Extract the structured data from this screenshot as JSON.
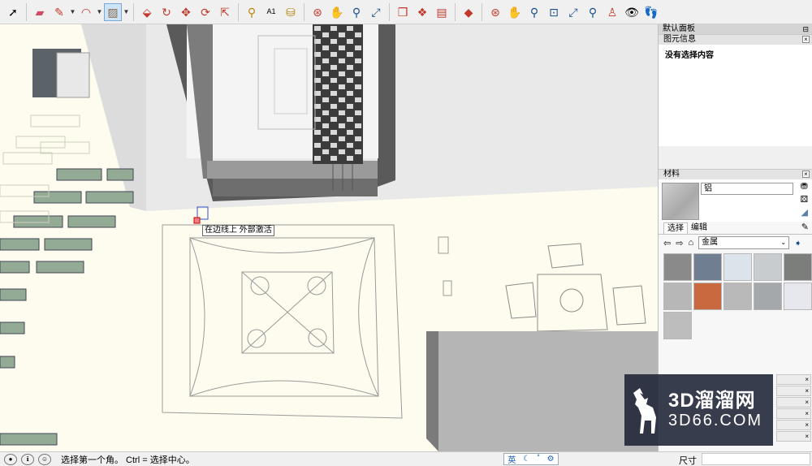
{
  "toolbar": {
    "icons": [
      "select",
      "eraser",
      "pencil",
      "arc",
      "rectangle",
      "push-pull",
      "follow-me",
      "move",
      "rotate",
      "scale",
      "tape-measure",
      "text",
      "paint-bucket",
      "orbit",
      "pan",
      "zoom",
      "zoom-extents",
      "component",
      "group",
      "style",
      "ruby",
      "orbit2",
      "pan2",
      "zoom2",
      "zoom-window",
      "zoom-extents2",
      "previous-view",
      "position-camera",
      "look-around",
      "walk"
    ]
  },
  "viewport": {
    "tooltip": "在边线上 外部激活"
  },
  "panel": {
    "tray_title": "默认面板",
    "entity_info": {
      "title": "图元信息",
      "content": "没有选择内容"
    },
    "materials": {
      "title": "材料",
      "name": "铝",
      "tabs": {
        "select": "选择",
        "edit": "编辑"
      },
      "collection": "金属",
      "swatches": [
        "#8a8a8a",
        "#6f7e91",
        "#dde3ea",
        "#c9ccce",
        "#7c7e7c",
        "#b7b7b7",
        "#c8693f",
        "#b9b9b9",
        "#a4a8aa",
        "#e6e8ee",
        "#bdbdbd"
      ]
    }
  },
  "watermark": {
    "line1": "3D溜溜网",
    "line2": "3D66.COM"
  },
  "status": {
    "hint": "选择第一个角。 Ctrl = 选择中心。",
    "ime": "英",
    "dimension_label": "尺寸",
    "dimension_value": ""
  }
}
